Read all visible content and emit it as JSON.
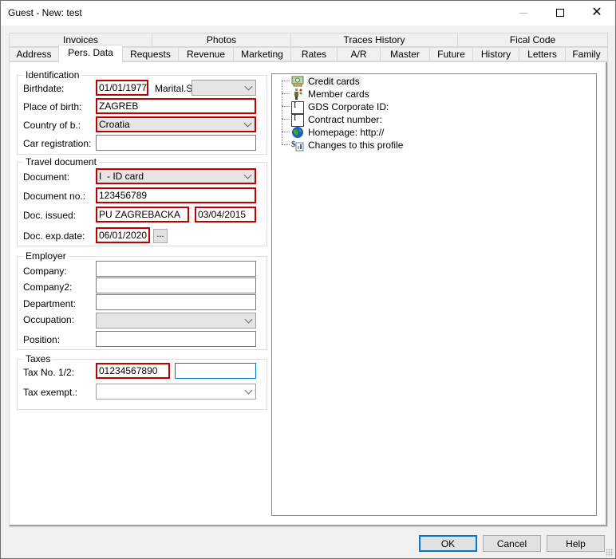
{
  "window": {
    "title": "Guest - New: test",
    "controls": {
      "minimize": "minimize",
      "maximize": "maximize",
      "close": "close"
    }
  },
  "tabs": {
    "row_top": [
      "Invoices",
      "Photos",
      "Traces History",
      "Fical Code"
    ],
    "row_bottom": [
      "Address",
      "Pers. Data",
      "Requests",
      "Revenue",
      "Marketing",
      "Rates",
      "A/R",
      "Master",
      "Future",
      "History",
      "Letters",
      "Family"
    ],
    "active": "Pers. Data"
  },
  "identification": {
    "title": "Identification",
    "birthdate_label": "Birthdate:",
    "birthdate_value": "01/01/1977",
    "marital_label": "Marital.St",
    "marital_value": "",
    "place_of_birth_label": "Place of birth:",
    "place_of_birth_value": "ZAGREB",
    "country_label": "Country of b.:",
    "country_value": "Croatia",
    "car_reg_label": "Car registration:",
    "car_reg_value": ""
  },
  "travel_document": {
    "title": "Travel document",
    "document_label": "Document:",
    "document_value": "I  - ID card",
    "document_no_label": "Document no.:",
    "document_no_value": "123456789",
    "doc_issued_label": "Doc. issued:",
    "doc_issued_by_value": "PU ZAGREBACKA",
    "doc_issued_date_value": "03/04/2015",
    "doc_exp_label": "Doc. exp.date:",
    "doc_exp_value": "06/01/2020",
    "picker_label": "..."
  },
  "employer": {
    "title": "Employer",
    "company_label": "Company:",
    "company_value": "",
    "company2_label": "Company2:",
    "company2_value": "",
    "department_label": "Department:",
    "department_value": "",
    "occupation_label": "Occupation:",
    "occupation_value": "",
    "position_label": "Position:",
    "position_value": ""
  },
  "taxes": {
    "title": "Taxes",
    "tax_no_label": "Tax No. 1/2:",
    "tax_no1_value": "01234567890",
    "tax_no2_value": "",
    "tax_exempt_label": "Tax exempt.:",
    "tax_exempt_value": ""
  },
  "tree": {
    "items": [
      {
        "label": "Credit cards",
        "icon": "credit-card-icon"
      },
      {
        "label": "Member cards",
        "icon": "member-card-icon"
      },
      {
        "label": "GDS Corporate ID:",
        "icon": "text-field-icon"
      },
      {
        "label": "Contract number:",
        "icon": "text-field-icon"
      },
      {
        "label": "Homepage: http://",
        "icon": "globe-icon"
      },
      {
        "label": "Changes to this profile",
        "icon": "history-log-icon"
      }
    ]
  },
  "buttons": {
    "ok": "OK",
    "cancel": "Cancel",
    "help": "Help"
  },
  "colors": {
    "required_border": "#c00000",
    "focus_border": "#0078d7"
  }
}
